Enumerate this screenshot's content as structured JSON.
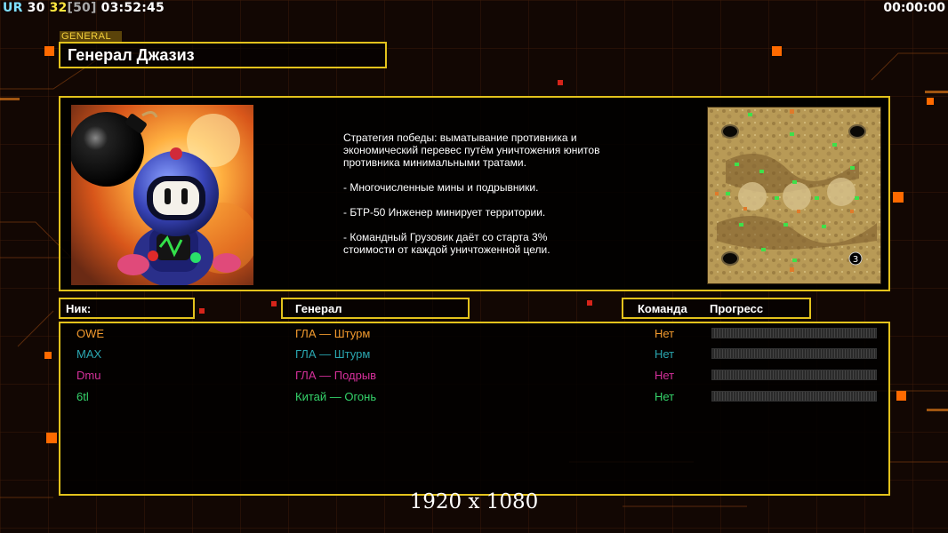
{
  "hud": {
    "ur_label": "UR",
    "val1": "30",
    "val2": "32",
    "val3": "[50]",
    "time": "03:52:45",
    "clock": "00:00:00"
  },
  "general": {
    "tag": "GENERAL",
    "name": "Генерал Джазиз",
    "description": "Стратегия победы: выматывание противника и\n экономический перевес путём уничтожения юнитов\n противника минимальными тратами.\n\n- Многочисленные мины и подрывники.\n\n- БТР-50 Инженер минирует территории.\n\n- Командный Грузовик даёт со старта 3%\n стоимости от каждой уничтоженной цели.",
    "portrait_icon": "bomberman-portrait-icon",
    "map_icon": "minimap-icon",
    "map_player_count": "3"
  },
  "table": {
    "headers": {
      "nick": "Ник:",
      "general": "Генерал",
      "team": "Команда",
      "progress": "Прогресс"
    },
    "rows": [
      {
        "nick": "OWE",
        "general": "ГЛА — Штурм",
        "team": "Нет",
        "progress": 0,
        "color": "#f29a2e"
      },
      {
        "nick": "MAX",
        "general": "ГЛА — Штурм",
        "team": "Нет",
        "progress": 0,
        "color": "#2aa6b0"
      },
      {
        "nick": "Dmu",
        "general": "ГЛА — Подрыв",
        "team": "Нет",
        "progress": 0,
        "color": "#d5309a"
      },
      {
        "nick": "6tl",
        "general": "Китай — Огонь",
        "team": "Нет",
        "progress": 0,
        "color": "#35d46a"
      }
    ]
  },
  "resolution": "1920 x 1080",
  "colors": {
    "accent": "#e3c21c",
    "background": "#120703"
  }
}
